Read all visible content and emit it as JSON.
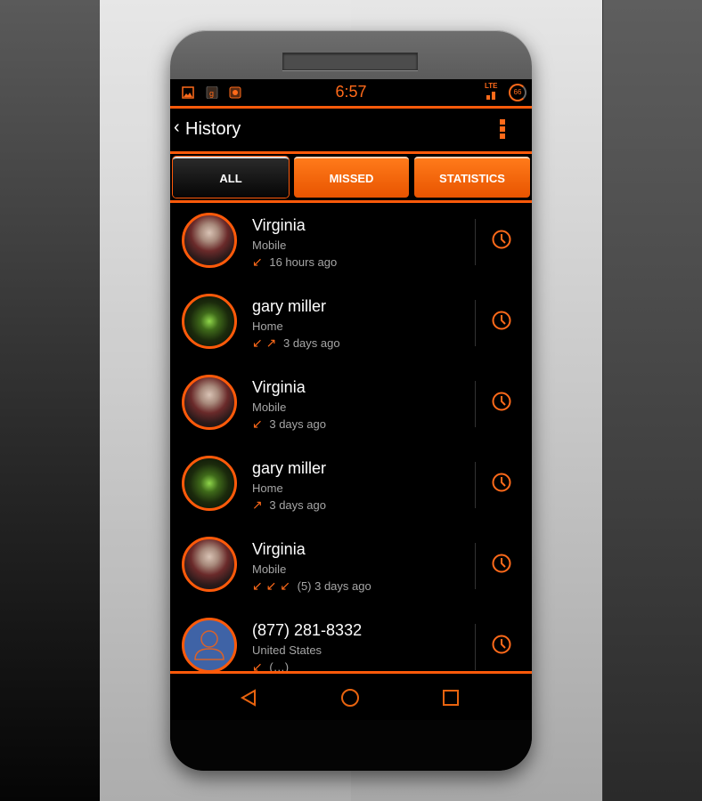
{
  "statusbar": {
    "time": "6:57",
    "network": "LTE",
    "battery": "66",
    "notification_icons": [
      "gallery-icon",
      "google-plus-icon",
      "app-icon"
    ]
  },
  "appbar": {
    "back_glyph": "‹",
    "title": "History",
    "menu_icon": "overflow-menu-icon"
  },
  "tabs": [
    {
      "label": "ALL",
      "active": true
    },
    {
      "label": "MISSED",
      "active": false
    },
    {
      "label": "STATISTICS",
      "active": false
    }
  ],
  "calls": [
    {
      "name": "Virginia",
      "type": "Mobile",
      "arrows": "↙",
      "time": "16 hours ago",
      "avatar": "virginia"
    },
    {
      "name": "gary miller",
      "type": "Home",
      "arrows": "↙ ↗",
      "time": "3 days ago",
      "avatar": "gary"
    },
    {
      "name": "Virginia",
      "type": "Mobile",
      "arrows": "↙",
      "time": "3 days ago",
      "avatar": "virginia"
    },
    {
      "name": "gary miller",
      "type": "Home",
      "arrows": "↗",
      "time": "3 days ago",
      "avatar": "gary"
    },
    {
      "name": "Virginia",
      "type": "Mobile",
      "arrows": "↙ ↙ ↙",
      "time": "(5) 3 days ago",
      "avatar": "virginia"
    },
    {
      "name": "(877) 281-8332",
      "type": "United States",
      "arrows": "↙",
      "time": "(…)",
      "avatar": "unknown"
    }
  ],
  "navbar": {
    "back": "back-icon",
    "home": "home-icon",
    "recents": "recents-icon"
  },
  "colors": {
    "accent": "#ff5a0a",
    "text": "#ffffff",
    "secondary_text": "#a6a6a6",
    "background": "#000000"
  }
}
